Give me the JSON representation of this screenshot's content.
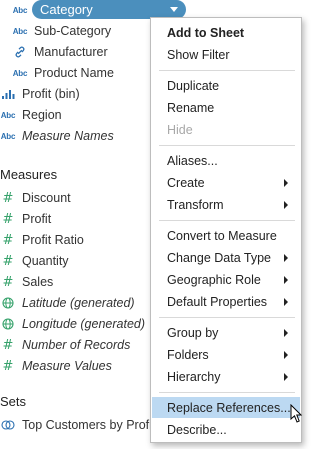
{
  "data_pane": {
    "dimensions": [
      {
        "label": "Category",
        "icon": "abc-icon",
        "selected": true
      },
      {
        "label": "Sub-Category",
        "icon": "abc-icon"
      },
      {
        "label": "Manufacturer",
        "icon": "link-icon"
      },
      {
        "label": "Product Name",
        "icon": "abc-icon"
      },
      {
        "label": "Profit (bin)",
        "icon": "bin-bars-icon"
      },
      {
        "label": "Region",
        "icon": "abc-icon"
      },
      {
        "label": "Measure Names",
        "icon": "abc-icon",
        "italic": true
      }
    ],
    "measures_title": "Measures",
    "measures": [
      {
        "label": "Discount",
        "icon": "number-icon"
      },
      {
        "label": "Profit",
        "icon": "number-icon"
      },
      {
        "label": "Profit Ratio",
        "icon": "number-icon"
      },
      {
        "label": "Quantity",
        "icon": "number-icon"
      },
      {
        "label": "Sales",
        "icon": "number-icon"
      },
      {
        "label": "Latitude (generated)",
        "icon": "globe-icon",
        "italic": true
      },
      {
        "label": "Longitude (generated)",
        "icon": "globe-icon",
        "italic": true
      },
      {
        "label": "Number of Records",
        "icon": "number-icon",
        "italic": true
      },
      {
        "label": "Measure Values",
        "icon": "number-icon",
        "italic": true
      }
    ],
    "sets_title": "Sets",
    "sets": [
      {
        "label": "Top Customers by Profit",
        "icon": "set-icon"
      }
    ]
  },
  "context_menu": {
    "items": [
      {
        "label": "Add to Sheet",
        "bold": true
      },
      {
        "label": "Show Filter"
      },
      {
        "label": "Duplicate"
      },
      {
        "label": "Rename"
      },
      {
        "label": "Hide",
        "disabled": true
      },
      {
        "label": "Aliases..."
      },
      {
        "label": "Create",
        "submenu": true
      },
      {
        "label": "Transform",
        "submenu": true
      },
      {
        "label": "Convert to Measure"
      },
      {
        "label": "Change Data Type",
        "submenu": true
      },
      {
        "label": "Geographic Role",
        "submenu": true
      },
      {
        "label": "Default Properties",
        "submenu": true
      },
      {
        "label": "Group by",
        "submenu": true
      },
      {
        "label": "Folders",
        "submenu": true
      },
      {
        "label": "Hierarchy",
        "submenu": true
      },
      {
        "label": "Replace References...",
        "highlighted": true
      },
      {
        "label": "Describe..."
      }
    ]
  },
  "colors": {
    "selected_pill": "#4b8fbd",
    "dimension_icon": "#2a6fb0",
    "measure_icon": "#36a26b",
    "menu_highlight": "#bcd9f2"
  }
}
